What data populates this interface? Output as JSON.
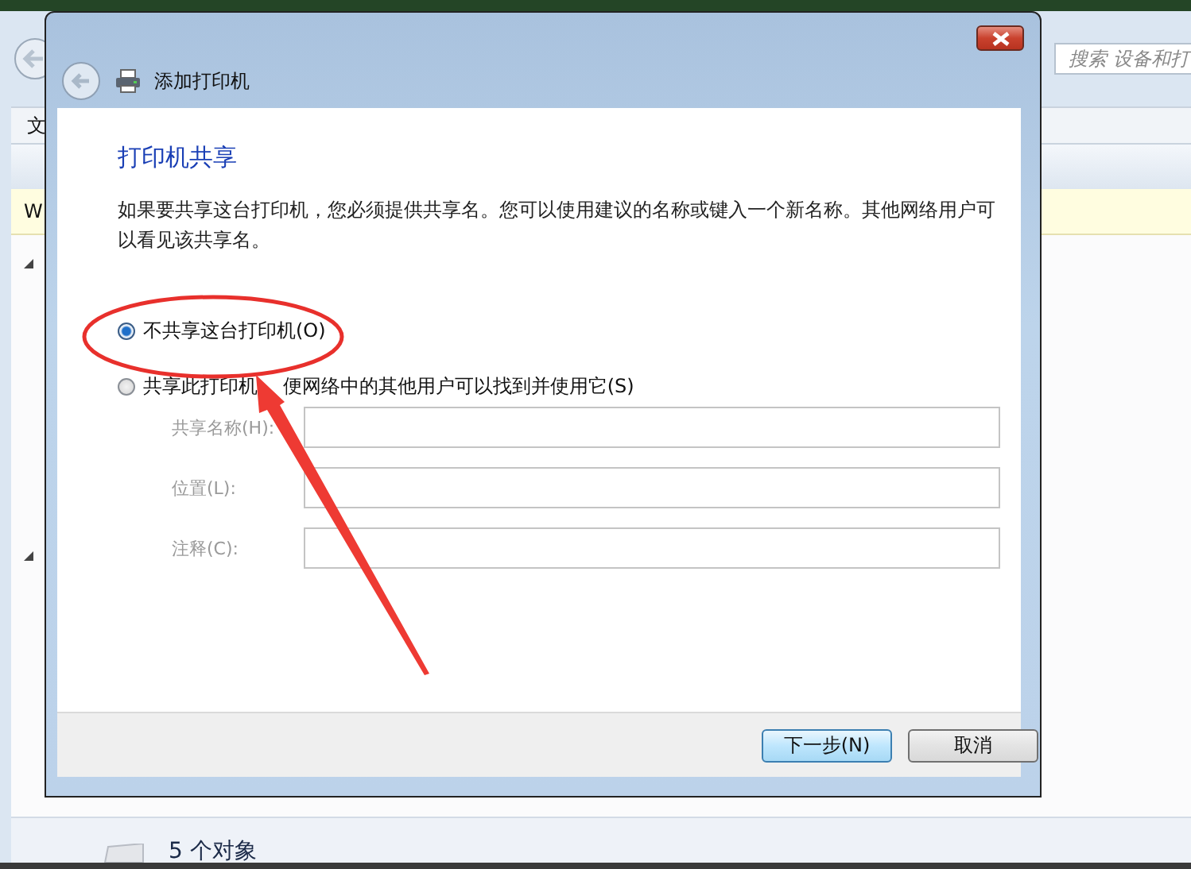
{
  "background_window": {
    "menu_label": "文",
    "notification": "W",
    "search": {
      "placeholder": "搜索 设备和打"
    },
    "status": "5 个对象"
  },
  "dialog": {
    "title": "添加打印机",
    "heading": "打印机共享",
    "description": "如果要共享这台打印机，您必须提供共享名。您可以使用建议的名称或键入一个新名称。其他网络用户可以看见该共享名。",
    "options": [
      {
        "label": "不共享这台打印机(O)",
        "selected": true
      },
      {
        "label": "共享此打印机 便网络中的其他用户可以找到并使用它(S)",
        "selected": false
      }
    ],
    "fields": [
      {
        "label": "共享名称(H):",
        "disabled": true
      },
      {
        "label": "位置(L):",
        "disabled": true
      },
      {
        "label": "注释(C):",
        "disabled": true
      }
    ],
    "buttons": [
      {
        "label": "下一步(N)",
        "kind": "default"
      },
      {
        "label": "取消",
        "kind": "normal"
      }
    ]
  }
}
